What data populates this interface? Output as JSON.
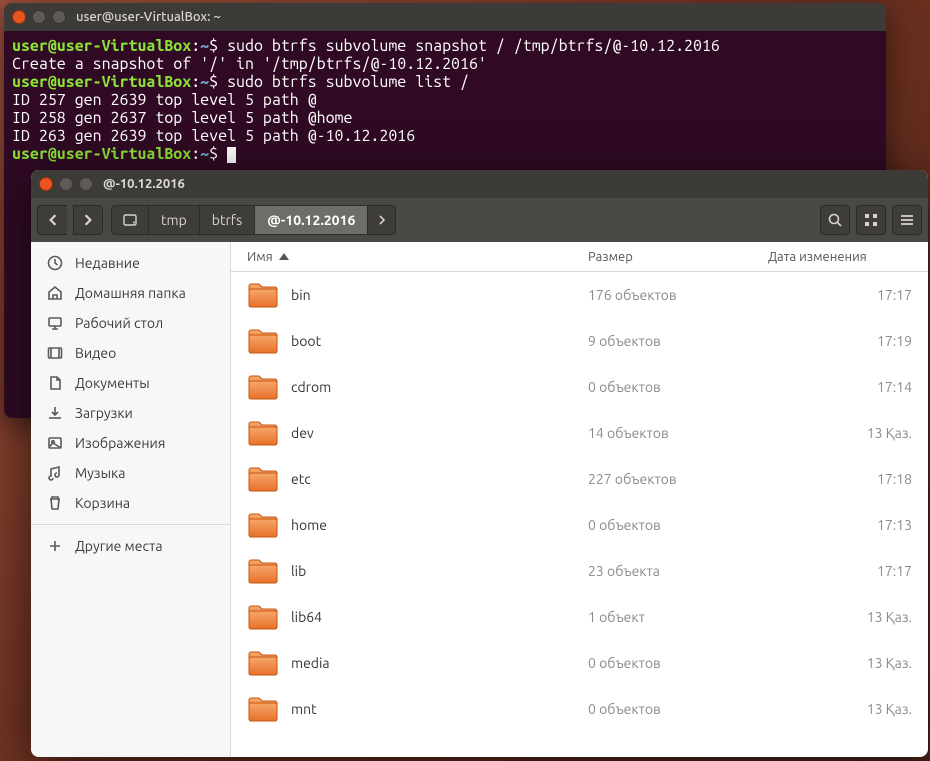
{
  "terminal": {
    "title": "user@user-VirtualBox: ~",
    "prompt_user": "user@user-VirtualBox",
    "prompt_path": "~",
    "lines": [
      {
        "type": "cmd",
        "text": "sudo btrfs subvolume snapshot / /tmp/btrfs/@-10.12.2016"
      },
      {
        "type": "out",
        "text": "Create a snapshot of '/' in '/tmp/btrfs/@-10.12.2016'"
      },
      {
        "type": "cmd",
        "text": "sudo btrfs subvolume list /"
      },
      {
        "type": "out",
        "text": "ID 257 gen 2639 top level 5 path @"
      },
      {
        "type": "out",
        "text": "ID 258 gen 2637 top level 5 path @home"
      },
      {
        "type": "out",
        "text": "ID 263 gen 2639 top level 5 path @-10.12.2016"
      },
      {
        "type": "cmd",
        "text": ""
      }
    ]
  },
  "files": {
    "title": "@-10.12.2016",
    "breadcrumbs": [
      "tmp",
      "btrfs",
      "@-10.12.2016"
    ],
    "active_crumb_index": 2,
    "columns": {
      "name": "Имя",
      "size": "Размер",
      "date": "Дата изменения"
    },
    "sidebar": [
      {
        "icon": "clock",
        "label": "Недавние"
      },
      {
        "icon": "home",
        "label": "Домашняя папка"
      },
      {
        "icon": "desktop",
        "label": "Рабочий стол"
      },
      {
        "icon": "video",
        "label": "Видео"
      },
      {
        "icon": "doc",
        "label": "Документы"
      },
      {
        "icon": "download",
        "label": "Загрузки"
      },
      {
        "icon": "image",
        "label": "Изображения"
      },
      {
        "icon": "music",
        "label": "Музыка"
      },
      {
        "icon": "trash",
        "label": "Корзина"
      }
    ],
    "other_places": "Другие места",
    "rows": [
      {
        "name": "bin",
        "size": "176 объектов",
        "date": "17:17"
      },
      {
        "name": "boot",
        "size": "9 объектов",
        "date": "17:19"
      },
      {
        "name": "cdrom",
        "size": "0 объектов",
        "date": "17:14"
      },
      {
        "name": "dev",
        "size": "14 объектов",
        "date": "13 Қаз."
      },
      {
        "name": "etc",
        "size": "227 объектов",
        "date": "17:18"
      },
      {
        "name": "home",
        "size": "0 объектов",
        "date": "17:13"
      },
      {
        "name": "lib",
        "size": "23 объекта",
        "date": "17:17"
      },
      {
        "name": "lib64",
        "size": "1 объект",
        "date": "13 Қаз."
      },
      {
        "name": "media",
        "size": "0 объектов",
        "date": "13 Қаз."
      },
      {
        "name": "mnt",
        "size": "0 объектов",
        "date": "13 Қаз."
      }
    ]
  }
}
